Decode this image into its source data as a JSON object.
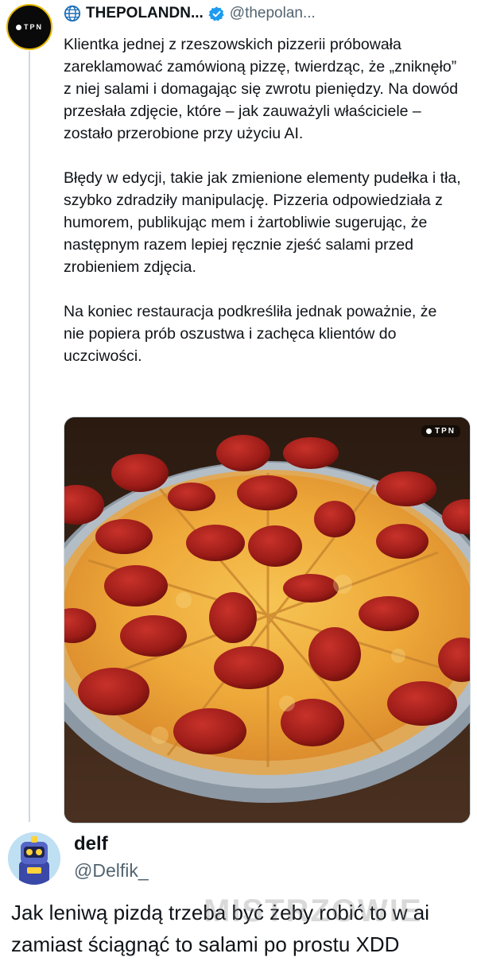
{
  "tweet": {
    "author_name": "THEPOLANDN...",
    "handle": "@thepolan...",
    "avatar_text": "TPN",
    "text": "Klientka jednej z rzeszowskich pizzerii próbowała zareklamować zamówioną pizzę, twierdząc, że „zniknęło” z niej salami i domagając się zwrotu pieniędzy. Na dowód przesłała zdjęcie, które – jak zauważyli właściciele – zostało przerobione przy użyciu AI.\n\nBłędy w edycji, takie jak zmienione elementy pudełka i tła, szybko zdradziły manipulację. Pizzeria odpowiedziała z humorem, publikując mem i żartobliwie sugerując, że następnym razem lepiej ręcznie zjeść salami przed zrobieniem zdjęcia.\n\nNa koniec restauracja podkreśliła jednak poważnie, że nie popiera prób oszustwa i zachęca klientów do uczciwości.",
    "media_watermark": "TPN",
    "icons": {
      "globe": "globe-icon",
      "verified": "verified-badge-icon"
    },
    "colors": {
      "verified": "#1d9bf0",
      "handle": "#536471",
      "thread_line": "#cfd9de"
    }
  },
  "reply": {
    "name": "delf",
    "handle": "@Delfik_",
    "text": "Jak leniwą pizdą trzeba być żeby robić to w ai zamiast ściągnąć to salami po prostu XDD"
  },
  "site_watermark": "MISTRZOWIE"
}
